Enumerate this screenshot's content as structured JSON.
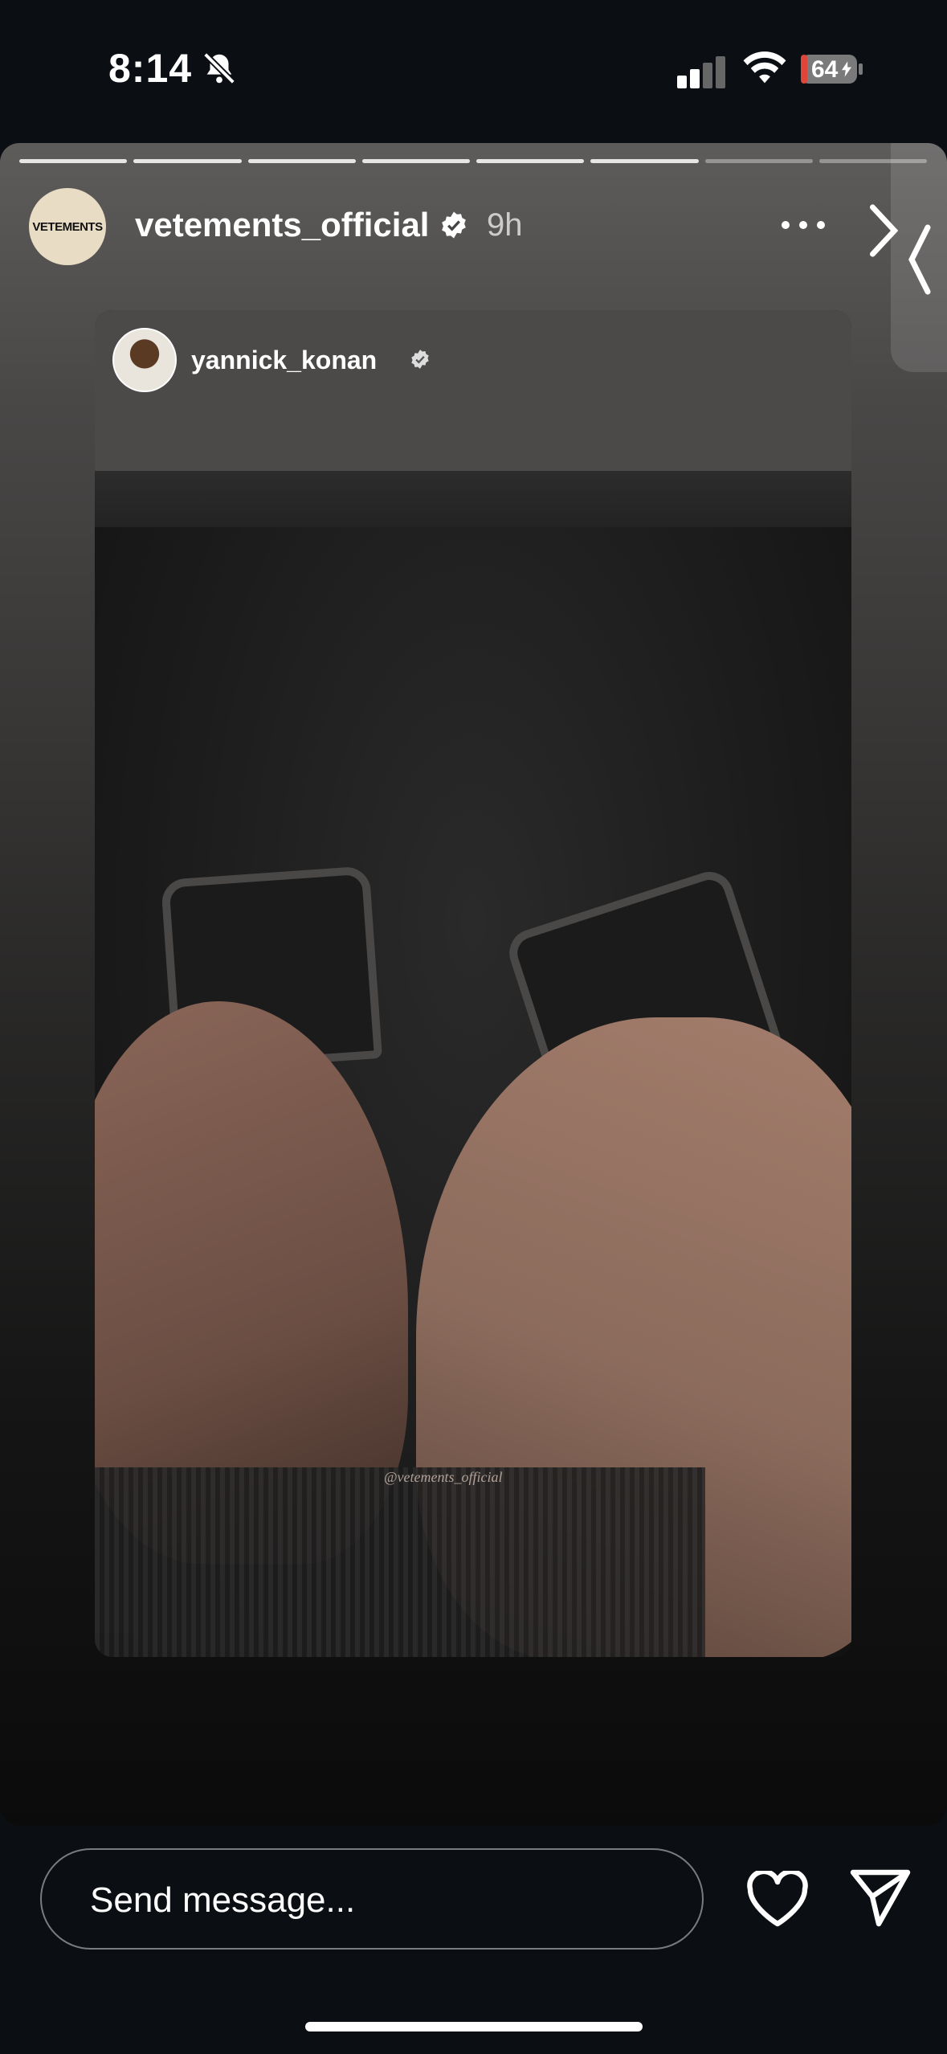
{
  "status_bar": {
    "time": "8:14",
    "battery": "64"
  },
  "story": {
    "account": {
      "username": "vetements_official",
      "avatar_text": "VETEMENTS",
      "age": "9h"
    },
    "progress": {
      "segments": 8,
      "current_index": 6
    },
    "reposted": {
      "username": "yannick_konan",
      "mention": "@vetements_official"
    }
  },
  "reply": {
    "placeholder": "Send message..."
  },
  "icons": {
    "muted": "bell-slash-icon",
    "verified": "verified-badge-icon",
    "more": "more-icon",
    "next": "chevron-right-icon",
    "like": "heart-icon",
    "share": "send-icon"
  },
  "colors": {
    "background": "#0b0f14",
    "battery_low": "#e0453a"
  }
}
